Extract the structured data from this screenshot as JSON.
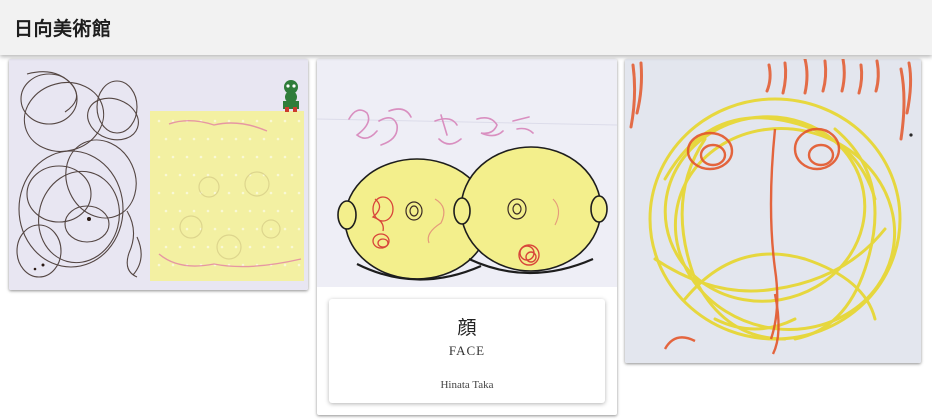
{
  "app": {
    "title": "日向美術館"
  },
  "gallery": {
    "items": [
      {
        "id": "artwork-1",
        "icon": "scribble-drawing",
        "colors": {
          "paper": "#eceaf4",
          "ink": "#3a2a24",
          "yellow_paper": "#f3f0a2",
          "sticker_green": "#2f7d3a"
        }
      },
      {
        "id": "artwork-2",
        "icon": "face-drawing",
        "caption": {
          "title": "顔",
          "subtitle": "FACE",
          "artist": "Hinata Taka"
        },
        "colors": {
          "paper": "#eeeef6",
          "face": "#f3ef8c",
          "pink": "#d98fc0",
          "red": "#d8453a"
        }
      },
      {
        "id": "artwork-3",
        "icon": "crayon-drawing",
        "colors": {
          "paper": "#dfe3ec",
          "yellow": "#e7d62b",
          "orange": "#e3562a"
        }
      }
    ]
  }
}
